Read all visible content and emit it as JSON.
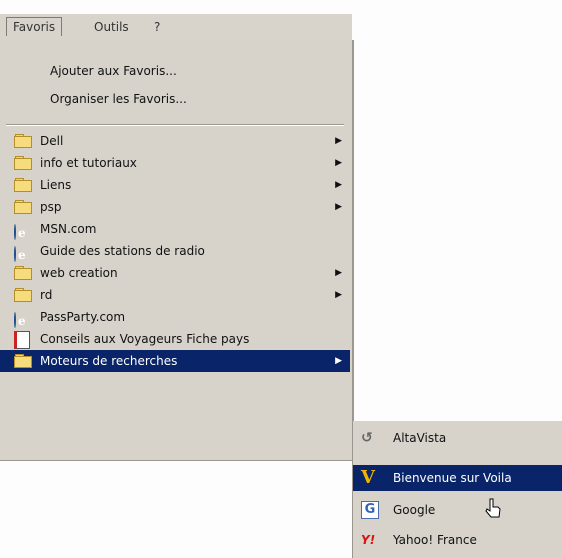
{
  "menubar": {
    "items": [
      {
        "label": "Favoris"
      },
      {
        "label": "Outils"
      },
      {
        "label": "?"
      }
    ]
  },
  "favorites_menu": {
    "top_items": [
      {
        "label": "Ajouter aux Favoris..."
      },
      {
        "label": "Organiser les Favoris..."
      }
    ],
    "items": [
      {
        "label": "Dell",
        "icon": "folder-icon",
        "submenu": true
      },
      {
        "label": "info et tutoriaux",
        "icon": "folder-icon",
        "submenu": true
      },
      {
        "label": "Liens",
        "icon": "folder-icon",
        "submenu": true
      },
      {
        "label": "psp",
        "icon": "folder-icon",
        "submenu": true
      },
      {
        "label": "MSN.com",
        "icon": "ie-link-icon",
        "submenu": false
      },
      {
        "label": "Guide des stations de radio",
        "icon": "ie-link-icon",
        "submenu": false
      },
      {
        "label": "web creation",
        "icon": "folder-icon",
        "submenu": true
      },
      {
        "label": "rd",
        "icon": "folder-icon",
        "submenu": true
      },
      {
        "label": "PassParty.com",
        "icon": "ie-link-icon",
        "submenu": false
      },
      {
        "label": "Conseils aux Voyageurs Fiche pays",
        "icon": "page-icon",
        "submenu": false
      },
      {
        "label": "Moteurs de recherches",
        "icon": "folder-icon",
        "submenu": true,
        "selected": true
      }
    ]
  },
  "search_submenu": {
    "items": [
      {
        "label": "AltaVista",
        "icon": "altavista-icon"
      },
      {
        "label": "Bienvenue sur Voila",
        "icon": "voila-icon",
        "selected": true
      },
      {
        "label": "Google",
        "icon": "google-icon"
      },
      {
        "label": "Yahoo! France",
        "icon": "yahoo-icon"
      }
    ]
  },
  "colors": {
    "menu_bg": "#d7d3cb",
    "selection_bg": "#0a246a",
    "folder": "#f6dc7c"
  }
}
